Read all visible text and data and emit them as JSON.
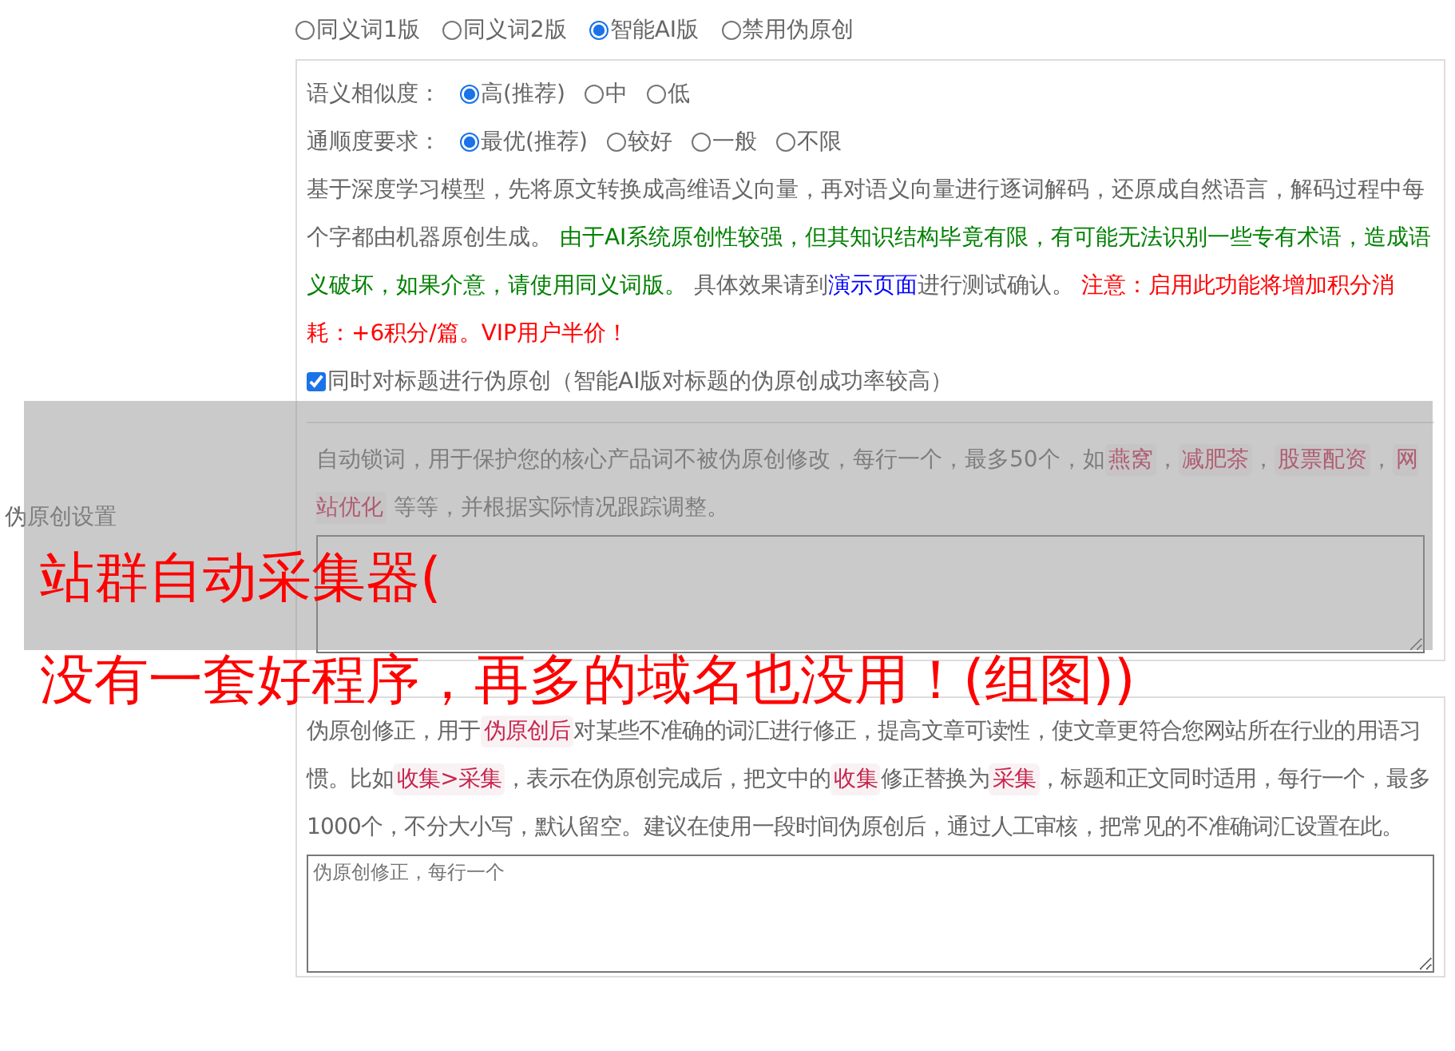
{
  "side_label": "伪原创设置",
  "modes": [
    {
      "label": "同义词1版",
      "selected": false
    },
    {
      "label": "同义词2版",
      "selected": false
    },
    {
      "label": "智能AI版",
      "selected": true
    },
    {
      "label": "禁用伪原创",
      "selected": false
    }
  ],
  "ai_settings": {
    "similarity": {
      "label": "语义相似度：",
      "options": [
        {
          "label": "高(推荐)",
          "selected": true
        },
        {
          "label": "中",
          "selected": false
        },
        {
          "label": "低",
          "selected": false
        }
      ]
    },
    "fluency": {
      "label": "通顺度要求：",
      "options": [
        {
          "label": "最优(推荐)",
          "selected": true
        },
        {
          "label": "较好",
          "selected": false
        },
        {
          "label": "一般",
          "selected": false
        },
        {
          "label": "不限",
          "selected": false
        }
      ]
    },
    "description": [
      {
        "kind": "plain",
        "text": "基于深度学习模型，先将原文转换成高维语义向量，再对语义向量进行逐词解码，还原成自然语言，解码过程中每个字都由机器原创生成。 "
      },
      {
        "kind": "green",
        "text": "由于AI系统原创性较强，但其知识结构毕竟有限，有可能无法识别一些专有术语，造成语义破坏，如果介意，请使用同义词版。"
      },
      {
        "kind": "plain",
        "text": " 具体效果请到"
      },
      {
        "kind": "link",
        "text": "演示页面"
      },
      {
        "kind": "plain",
        "text": "进行测试确认。 "
      },
      {
        "kind": "red",
        "text": "注意：启用此功能将增加积分消耗：+6积分/篇。VIP用户半价！"
      }
    ],
    "title_option": {
      "label": "同时对标题进行伪原创（智能AI版对标题的伪原创成功率较高）",
      "checked": true
    }
  },
  "lock_words": {
    "description": [
      {
        "kind": "plain",
        "text": "自动锁词，用于保护您的核心产品词不被伪原创修改，每行一个，最多50个，如"
      },
      {
        "kind": "code",
        "text": "燕窝"
      },
      {
        "kind": "plain",
        "text": "，"
      },
      {
        "kind": "code",
        "text": "减肥茶"
      },
      {
        "kind": "plain",
        "text": "，"
      },
      {
        "kind": "code",
        "text": "股票配资"
      },
      {
        "kind": "plain",
        "text": "，"
      },
      {
        "kind": "code",
        "text": "网站优化"
      },
      {
        "kind": "plain",
        "text": " 等等，并根据实际情况跟踪调整。"
      }
    ]
  },
  "corrections": {
    "description": [
      {
        "kind": "plain",
        "text": "伪原创修正，用于"
      },
      {
        "kind": "code",
        "text": "伪原创后"
      },
      {
        "kind": "plain",
        "text": "对某些不准确的词汇进行修正，提高文章可读性，使文章更符合您网站所在行业的用语习惯。比如"
      },
      {
        "kind": "code",
        "text": "收集>采集"
      },
      {
        "kind": "plain",
        "text": "，表示在伪原创完成后，把文中的"
      },
      {
        "kind": "code",
        "text": "收集"
      },
      {
        "kind": "plain",
        "text": "修正替换为"
      },
      {
        "kind": "code",
        "text": "采集"
      },
      {
        "kind": "plain",
        "text": "，标题和正文同时适用，每行一个，最多1000个，不分大小写，默认留空。建议在使用一段时间伪原创后，通过人工审核，把常见的不准确词汇设置在此。"
      }
    ],
    "placeholder": "伪原创修正，每行一个"
  },
  "overlay": {
    "title_lines": [
      "站群自动采集器(",
      "没有一套好程序，再多的域名也没用！(组图))"
    ]
  }
}
